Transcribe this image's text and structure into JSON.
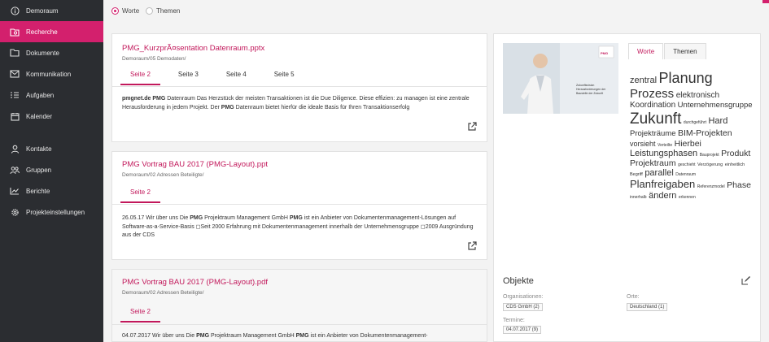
{
  "sidebar": {
    "items": [
      {
        "label": "Demoraum",
        "icon": "info-icon"
      },
      {
        "label": "Recherche",
        "icon": "search-doc-icon",
        "active": true
      },
      {
        "label": "Dokumente",
        "icon": "folder-icon"
      },
      {
        "label": "Kommunikation",
        "icon": "mail-icon"
      },
      {
        "label": "Aufgaben",
        "icon": "checklist-icon"
      },
      {
        "label": "Kalender",
        "icon": "calendar-icon"
      },
      {
        "label": "Kontakte",
        "icon": "person-icon"
      },
      {
        "label": "Gruppen",
        "icon": "group-icon"
      },
      {
        "label": "Berichte",
        "icon": "chart-icon"
      },
      {
        "label": "Projekteinstellungen",
        "icon": "gear-icon"
      }
    ]
  },
  "search_mode": {
    "worte": "Worte",
    "themen": "Themen",
    "selected": "Worte"
  },
  "results": [
    {
      "title": "PMG_KurzprÃ¤sentation Datenraum.pptx",
      "path": "Demoraum/05 Demodaten/",
      "tabs": [
        "Seite 2",
        "Seite 3",
        "Seite 4",
        "Seite 5"
      ],
      "active_tab": "Seite 2",
      "text": [
        {
          "t": "pmgnet.de",
          "b": true
        },
        {
          "t": " "
        },
        {
          "t": "PMG",
          "b": true
        },
        {
          "t": " Datenraum Das Herzstück der meisten Transaktionen ist die Due Diligence. Diese effizien: zu managen ist eine zentrale Herausforderung in jedem Projekt. Der "
        },
        {
          "t": "PMG",
          "b": true
        },
        {
          "t": " Datenraum bietet hierfür die ideale Basis für Ihren Transaktionserfolg"
        }
      ]
    },
    {
      "title": "PMG Vortrag BAU 2017 (PMG-Layout).ppt",
      "path": "Demoraum/02 Adressen Beteiligte/",
      "tabs": [
        "Seite 2"
      ],
      "active_tab": "Seite 2",
      "text": [
        {
          "t": "26.05.17 Wir über uns Die "
        },
        {
          "t": "PMG",
          "b": true
        },
        {
          "t": " Projektraum Management GmbH "
        },
        {
          "t": "PMG",
          "b": true
        },
        {
          "t": " ist ein Anbieter von Dokumentenmanagement-Lösungen auf Software-as-a-Service-Basis ◻Seit 2000 Erfahrung mit Dokumentenmanagement innerhalb der Unternehmensgruppe ◻2009 Ausgründung aus der CDS"
        }
      ]
    },
    {
      "title": "PMG Vortrag BAU 2017 (PMG-Layout).pdf",
      "path": "Demoraum/02 Adressen Beteiligte/",
      "tabs": [
        "Seite 2"
      ],
      "active_tab": "Seite 2",
      "text": [
        {
          "t": "04.07.2017 Wir über uns Die "
        },
        {
          "t": "PMG",
          "b": true
        },
        {
          "t": " Projektraum Management GmbH "
        },
        {
          "t": "PMG",
          "b": true
        },
        {
          "t": " ist ein Anbieter von Dokumentenmanagement-"
        }
      ]
    }
  ],
  "preview": {
    "thumb_caption": [
      "Zukunftsvision",
      "Herausforderungen der",
      "Baustelle der Zukunft"
    ],
    "thumb_badge": "PMG"
  },
  "wordcloud": {
    "tabs": [
      "Worte",
      "Themen"
    ],
    "active_tab": "Worte",
    "words": [
      {
        "w": "zentral",
        "s": 11
      },
      {
        "w": "Planung",
        "s": 18
      },
      {
        "w": "Prozess",
        "s": 15
      },
      {
        "w": "elektronisch",
        "s": 10
      },
      {
        "w": "Koordination",
        "s": 10
      },
      {
        "w": "Unternehmensgruppe",
        "s": 9.5
      },
      {
        "w": "Zukunft",
        "s": 19
      },
      {
        "w": "durchgeführt",
        "s": 5
      },
      {
        "w": "Hard",
        "s": 11
      },
      {
        "w": "Projekträume",
        "s": 9.5
      },
      {
        "w": "BIM-Projekten",
        "s": 10.5
      },
      {
        "w": "vorsieht",
        "s": 9
      },
      {
        "w": "Verteilte",
        "s": 5
      },
      {
        "w": "Hierbei",
        "s": 10.5
      },
      {
        "w": "Leistungsphasen",
        "s": 11
      },
      {
        "w": "Bauprojekt",
        "s": 5
      },
      {
        "w": "Produkt",
        "s": 10.5
      },
      {
        "w": "Projektraum",
        "s": 10.5
      },
      {
        "w": "geschieht",
        "s": 5
      },
      {
        "w": "Verzögerung",
        "s": 5.5
      },
      {
        "w": "einheitlich",
        "s": 5.5
      },
      {
        "w": "Begriff",
        "s": 5.5
      },
      {
        "w": "parallel",
        "s": 11
      },
      {
        "w": "Datenraum",
        "s": 5
      },
      {
        "w": "Planfreigaben",
        "s": 13
      },
      {
        "w": "Referenzmodel",
        "s": 5
      },
      {
        "w": "Phase",
        "s": 10.5
      },
      {
        "w": "innerhalb",
        "s": 5
      },
      {
        "w": "ändern",
        "s": 11
      },
      {
        "w": "erkennen",
        "s": 5
      }
    ]
  },
  "objects": {
    "title": "Objekte",
    "organisations_label": "Organisationen:",
    "organisations": [
      "CDS GmbH (2)"
    ],
    "places_label": "Orte:",
    "places": [
      "Deutschland (1)"
    ],
    "dates_label": "Termine:",
    "dates": [
      "04.07.2017 (9)"
    ]
  },
  "colors": {
    "accent": "#d3206d",
    "sidebar": "#2b2d31"
  }
}
